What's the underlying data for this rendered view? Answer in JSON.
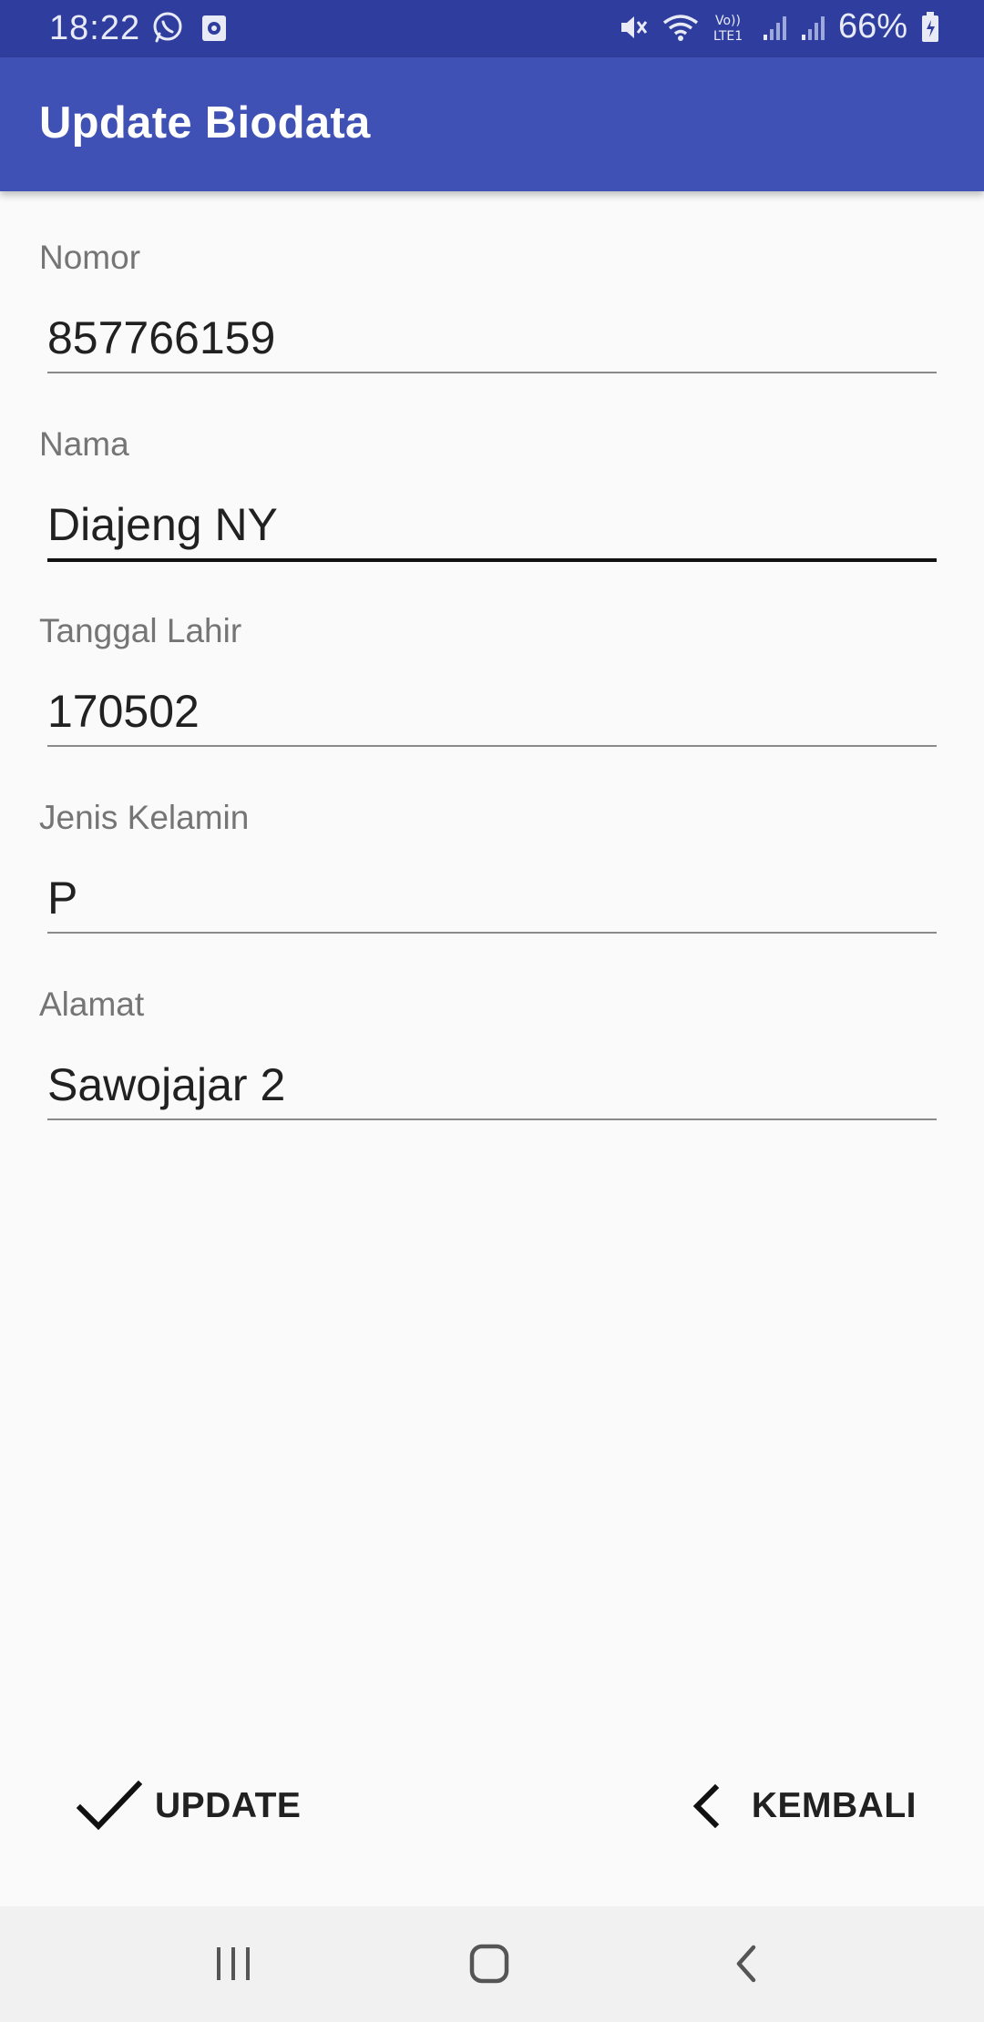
{
  "status_bar": {
    "time": "18:22",
    "battery": "66%",
    "left_icons": [
      "whatsapp-icon",
      "screen-record-icon"
    ],
    "right_icons": [
      "mute-icon",
      "wifi-icon",
      "volte-lte-icon",
      "signal-icon",
      "signal-icon-2",
      "battery-charging-icon"
    ],
    "background": "#2f3e9e"
  },
  "app_bar": {
    "title": "Update Biodata",
    "background": "#3f51b5"
  },
  "form": {
    "fields": [
      {
        "label": "Nomor",
        "value": "857766159",
        "focused": false
      },
      {
        "label": "Nama",
        "value": "Diajeng NY",
        "focused": true
      },
      {
        "label": "Tanggal Lahir",
        "value": "170502",
        "focused": false
      },
      {
        "label": "Jenis Kelamin",
        "value": "P",
        "focused": false
      },
      {
        "label": "Alamat",
        "value": "Sawojajar 2",
        "focused": false
      }
    ]
  },
  "buttons": {
    "update": {
      "label": "UPDATE",
      "icon": "checkmark-icon"
    },
    "kembali": {
      "label": "KEMBALI",
      "icon": "chevron-left-icon"
    }
  },
  "nav_bar": {
    "items": [
      "recents-icon",
      "home-icon",
      "back-icon"
    ]
  }
}
